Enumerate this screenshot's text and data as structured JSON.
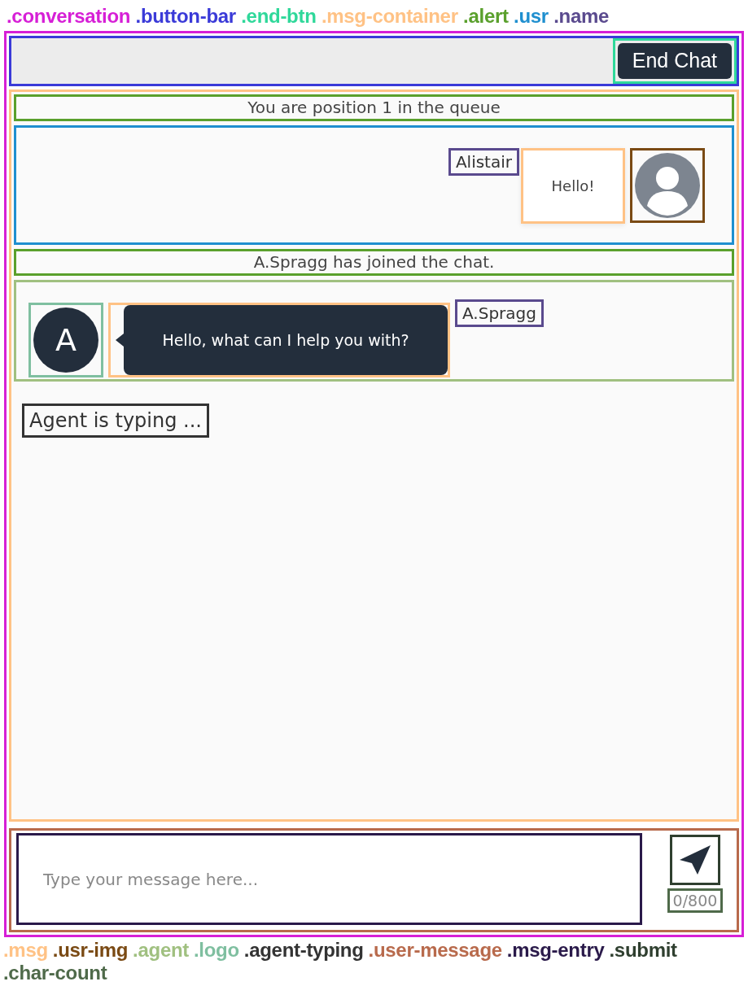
{
  "legend_top": [
    {
      "label": ".conversation",
      "color": "#d61fd6"
    },
    {
      "label": ".button-bar",
      "color": "#3a3ad8"
    },
    {
      "label": ".end-btn",
      "color": "#2fd89a"
    },
    {
      "label": ".msg-container",
      "color": "#ffc285"
    },
    {
      "label": ".alert",
      "color": "#5aa02c"
    },
    {
      "label": ".usr",
      "color": "#1f8fcf"
    },
    {
      "label": ".name",
      "color": "#5a4a8e"
    }
  ],
  "end_button": {
    "label": "End Chat"
  },
  "messages": [
    {
      "kind": "alert",
      "text": "You are position 1 in the queue"
    },
    {
      "kind": "user",
      "name": "Alistair",
      "text": "Hello!"
    },
    {
      "kind": "alert",
      "text": "A.Spragg has joined the chat."
    },
    {
      "kind": "agent",
      "name": "A.Spragg",
      "initial": "A",
      "text": "Hello, what can I help you with?"
    }
  ],
  "typing": "Agent is typing ...",
  "entry": {
    "placeholder": "Type your message here...",
    "char_count": "0/800"
  },
  "legend_bottom": [
    {
      "label": ".msg",
      "color": "#ffc285"
    },
    {
      "label": ".usr-img",
      "color": "#7a4a14"
    },
    {
      "label": ".agent",
      "color": "#a0c080"
    },
    {
      "label": ".logo",
      "color": "#7fbfa0"
    },
    {
      "label": ".agent-typing",
      "color": "#333333"
    },
    {
      "label": ".user-message",
      "color": "#b86a4c"
    },
    {
      "label": ".msg-entry",
      "color": "#2a1a4a"
    },
    {
      "label": ".submit",
      "color": "#2f3f2f"
    },
    {
      "label": ".char-count",
      "color": "#4f6a4a"
    }
  ]
}
